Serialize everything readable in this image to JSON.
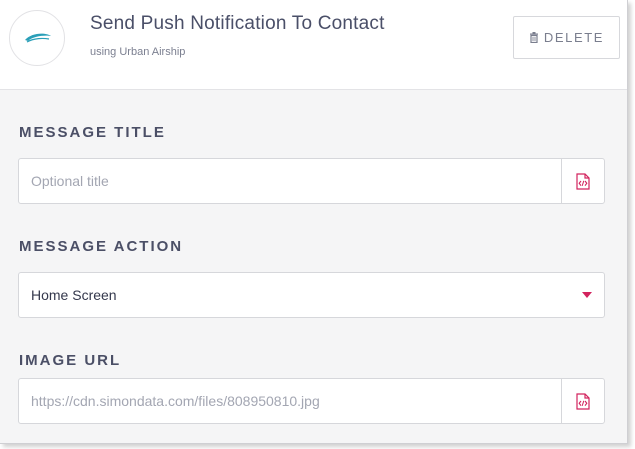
{
  "header": {
    "title": "Send Push Notification To Contact",
    "subtitle": "using Urban Airship",
    "logo_icon": "urban-airship-logo",
    "delete_label": "DELETE",
    "delete_icon": "trash-icon"
  },
  "fields": {
    "message_title": {
      "label": "MESSAGE TITLE",
      "value": "",
      "placeholder": "Optional title",
      "icon": "code-file-icon"
    },
    "message_action": {
      "label": "MESSAGE ACTION",
      "selected": "Home Screen",
      "icon": "dropdown-caret-icon"
    },
    "image_url": {
      "label": "IMAGE URL",
      "value": "",
      "placeholder": "https://cdn.simondata.com/files/808950810.jpg",
      "icon": "code-file-icon"
    }
  },
  "colors": {
    "accent": "#d2235d",
    "text_dark": "#4a4f68",
    "border": "#d6d7db",
    "panel_bg": "#f5f5f6"
  }
}
